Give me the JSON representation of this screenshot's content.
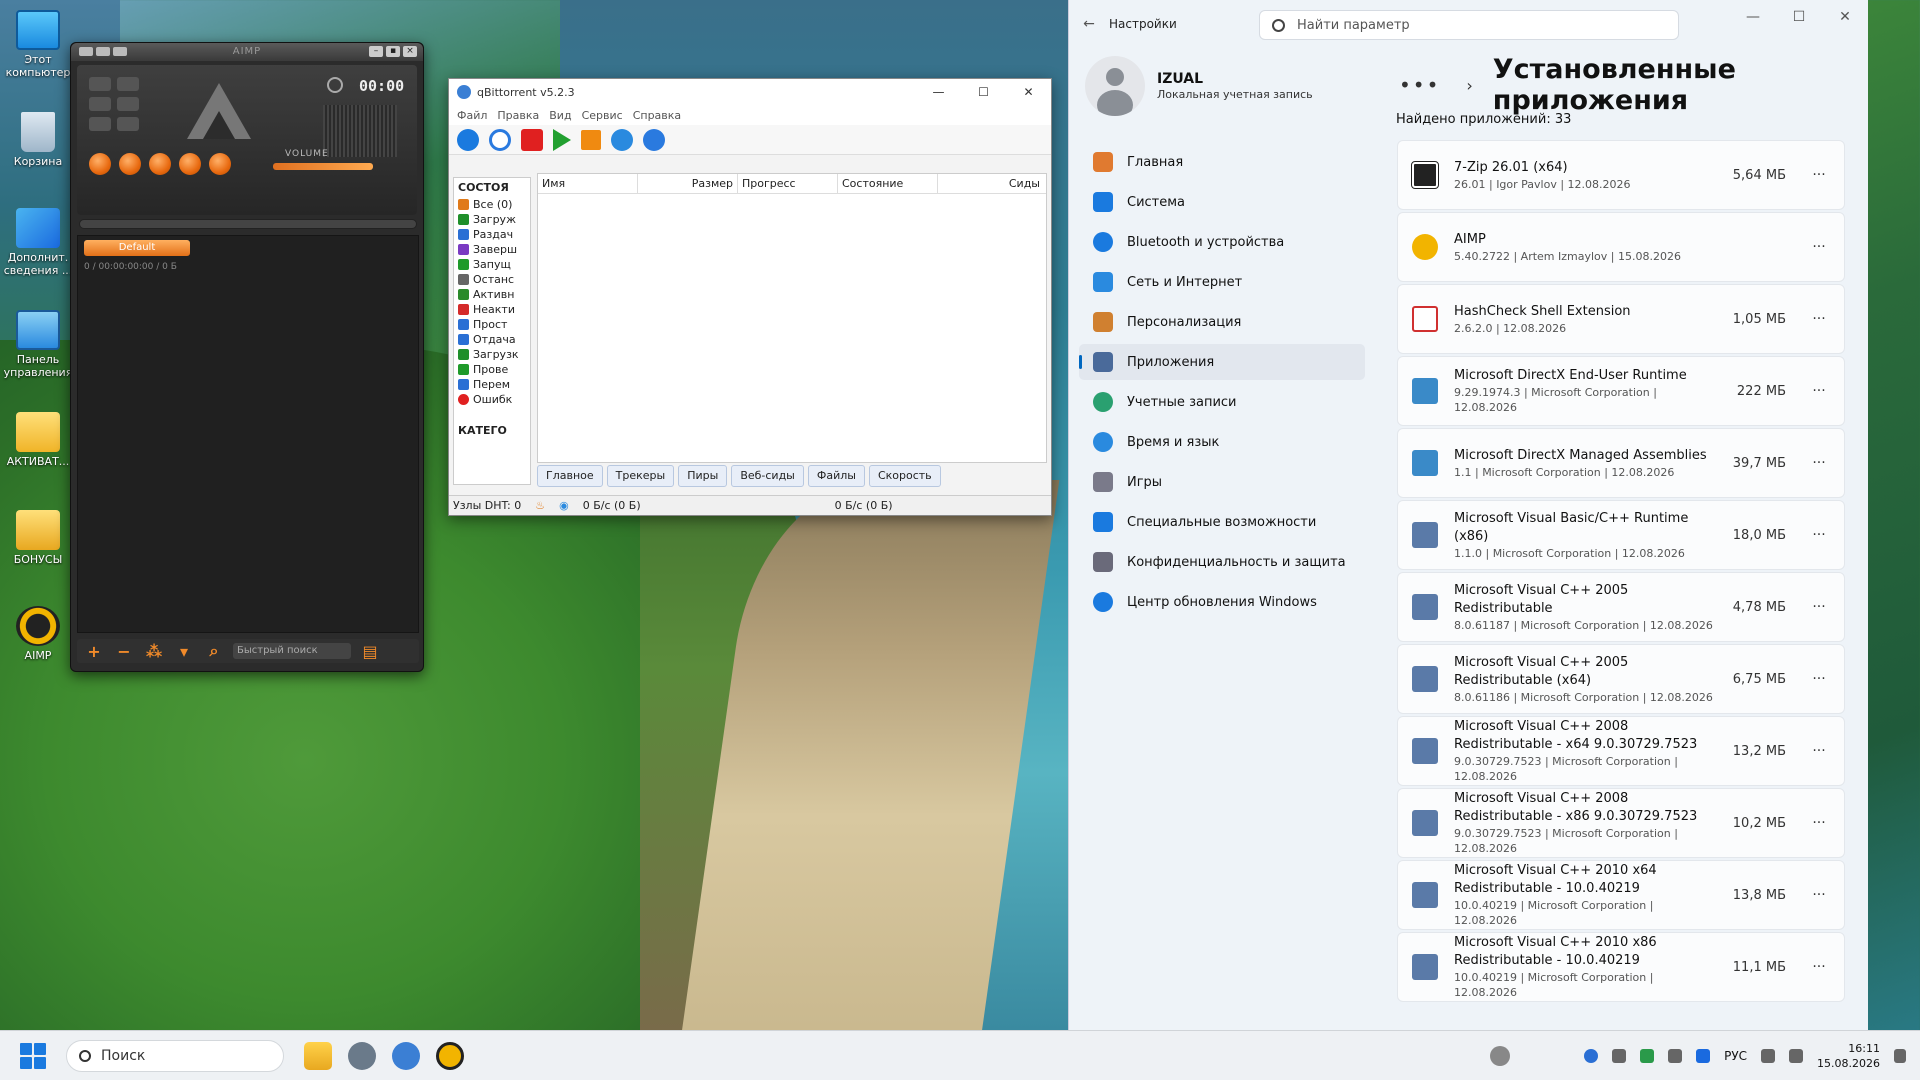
{
  "desktop": {
    "icons": [
      {
        "label": "Этот компьютер",
        "icon": "monitor-icon"
      },
      {
        "label": "Корзина",
        "icon": "recycle-bin-icon"
      },
      {
        "label": "Дополнит. сведения ...",
        "icon": "info-icon"
      },
      {
        "label": "Панель управления",
        "icon": "control-panel-icon"
      },
      {
        "label": "АКТИВАТ...",
        "icon": "folder-icon"
      },
      {
        "label": "БОНУСЫ",
        "icon": "folder-icon"
      },
      {
        "label": "AIMP",
        "icon": "aimp-icon"
      }
    ]
  },
  "aimp": {
    "title": "AIMP",
    "time": "00:00",
    "volume_label": "VOLUME",
    "playlist_tab": "Default",
    "playlist_info": "0 / 00:00:00:00 / 0 Б",
    "search_placeholder": "Быстрый поиск"
  },
  "qbittorrent": {
    "title": "qBittorrent v5.2.3",
    "menu": [
      "Файл",
      "Правка",
      "Вид",
      "Сервис",
      "Справка"
    ],
    "sidebar_header": "СОСТОЯ",
    "sidebar_items": [
      {
        "label": "Все (0)",
        "color": "#e07a1a"
      },
      {
        "label": "Загруж",
        "color": "#1f8f2a"
      },
      {
        "label": "Раздач",
        "color": "#2a6fd4"
      },
      {
        "label": "Заверш",
        "color": "#7a3ac2"
      },
      {
        "label": "Запущ",
        "color": "#1f9a2a"
      },
      {
        "label": "Останс",
        "color": "#666666"
      },
      {
        "label": "Активн",
        "color": "#2a8a2a"
      },
      {
        "label": "Неакти",
        "color": "#d42a2a"
      },
      {
        "label": "Прост",
        "color": "#2a6fd4"
      },
      {
        "label": "Отдача",
        "color": "#2a6fd4"
      },
      {
        "label": "Загрузк",
        "color": "#1f8f2a"
      },
      {
        "label": "Прове",
        "color": "#1f9a2a"
      },
      {
        "label": "Перем",
        "color": "#2a6fd4"
      },
      {
        "label": "Ошибк",
        "color": "#e02020"
      }
    ],
    "sidebar_footer": "КАТЕГО",
    "columns": [
      "Имя",
      "Размер",
      "Прогресс",
      "Состояние",
      "Сиды"
    ],
    "tabs": [
      "Главное",
      "Трекеры",
      "Пиры",
      "Веб-сиды",
      "Файлы",
      "Скорость"
    ],
    "status": {
      "dht": "Узлы DHT: 0",
      "down": "0 Б/с (0 Б)",
      "up": "0 Б/с (0 Б)"
    }
  },
  "settings": {
    "app_title": "Настройки",
    "search_placeholder": "Найти параметр",
    "user_name": "IZUAL",
    "user_type": "Локальная учетная запись",
    "nav": [
      {
        "label": "Главная",
        "icon": "home-icon",
        "color": "#e07a30"
      },
      {
        "label": "Система",
        "icon": "system-icon",
        "color": "#1a7adf"
      },
      {
        "label": "Bluetooth и устройства",
        "icon": "bluetooth-icon",
        "color": "#1a7adf"
      },
      {
        "label": "Сеть и Интернет",
        "icon": "network-icon",
        "color": "#2a8adf"
      },
      {
        "label": "Персонализация",
        "icon": "brush-icon",
        "color": "#d08030"
      },
      {
        "label": "Приложения",
        "icon": "apps-icon",
        "color": "#4a6a9a",
        "selected": true
      },
      {
        "label": "Учетные записи",
        "icon": "accounts-icon",
        "color": "#2aa070"
      },
      {
        "label": "Время и язык",
        "icon": "time-language-icon",
        "color": "#2a8adf"
      },
      {
        "label": "Игры",
        "icon": "gaming-icon",
        "color": "#7a7a8a"
      },
      {
        "label": "Специальные возможности",
        "icon": "accessibility-icon",
        "color": "#1a7adf"
      },
      {
        "label": "Конфиденциальность и защита",
        "icon": "privacy-shield-icon",
        "color": "#6a6a7a"
      },
      {
        "label": "Центр обновления Windows",
        "icon": "windows-update-icon",
        "color": "#1a7adf"
      }
    ],
    "page_title": "Установленные приложения",
    "found": "Найдено приложений: 33",
    "apps": [
      {
        "name": "7-Zip 26.01 (x64)",
        "meta": "26.01  |  Igor Pavlov  |  12.08.2026",
        "size": "5,64 МБ",
        "color": "#222222"
      },
      {
        "name": "AIMP",
        "meta": "5.40.2722  |  Artem Izmaylov  |  15.08.2026",
        "size": "",
        "color": "#f2b400"
      },
      {
        "name": "HashCheck Shell Extension",
        "meta": "2.6.2.0  |  12.08.2026",
        "size": "1,05 МБ",
        "color": "#d03030"
      },
      {
        "name": "Microsoft DirectX End-User Runtime",
        "meta": "9.29.1974.3  |  Microsoft Corporation  |  12.08.2026",
        "size": "222 МБ",
        "color": "#3a8ac8"
      },
      {
        "name": "Microsoft DirectX Managed Assemblies",
        "meta": "1.1  |  Microsoft Corporation  |  12.08.2026",
        "size": "39,7 МБ",
        "color": "#3a8ac8"
      },
      {
        "name": "Microsoft Visual Basic/C++ Runtime (x86)",
        "meta": "1.1.0  |  Microsoft Corporation  |  12.08.2026",
        "size": "18,0 МБ",
        "color": "#5a7aa8"
      },
      {
        "name": "Microsoft Visual C++ 2005 Redistributable",
        "meta": "8.0.61187  |  Microsoft Corporation  |  12.08.2026",
        "size": "4,78 МБ",
        "color": "#5a7aa8"
      },
      {
        "name": "Microsoft Visual C++ 2005 Redistributable (x64)",
        "meta": "8.0.61186  |  Microsoft Corporation  |  12.08.2026",
        "size": "6,75 МБ",
        "color": "#5a7aa8"
      },
      {
        "name": "Microsoft Visual C++ 2008 Redistributable - x64 9.0.30729.7523",
        "meta": "9.0.30729.7523  |  Microsoft Corporation  |  12.08.2026",
        "size": "13,2 МБ",
        "color": "#5a7aa8"
      },
      {
        "name": "Microsoft Visual C++ 2008 Redistributable - x86 9.0.30729.7523",
        "meta": "9.0.30729.7523  |  Microsoft Corporation  |  12.08.2026",
        "size": "10,2 МБ",
        "color": "#5a7aa8"
      },
      {
        "name": "Microsoft Visual C++ 2010  x64 Redistributable - 10.0.40219",
        "meta": "10.0.40219  |  Microsoft Corporation  |  12.08.2026",
        "size": "13,8 МБ",
        "color": "#5a7aa8"
      },
      {
        "name": "Microsoft Visual C++ 2010  x86 Redistributable - 10.0.40219",
        "meta": "10.0.40219  |  Microsoft Corporation  |  12.08.2026",
        "size": "11,1 МБ",
        "color": "#5a7aa8"
      }
    ]
  },
  "taskbar": {
    "search_placeholder": "Поиск",
    "lang": "РУС",
    "time": "16:11",
    "date": "15.08.2026"
  }
}
